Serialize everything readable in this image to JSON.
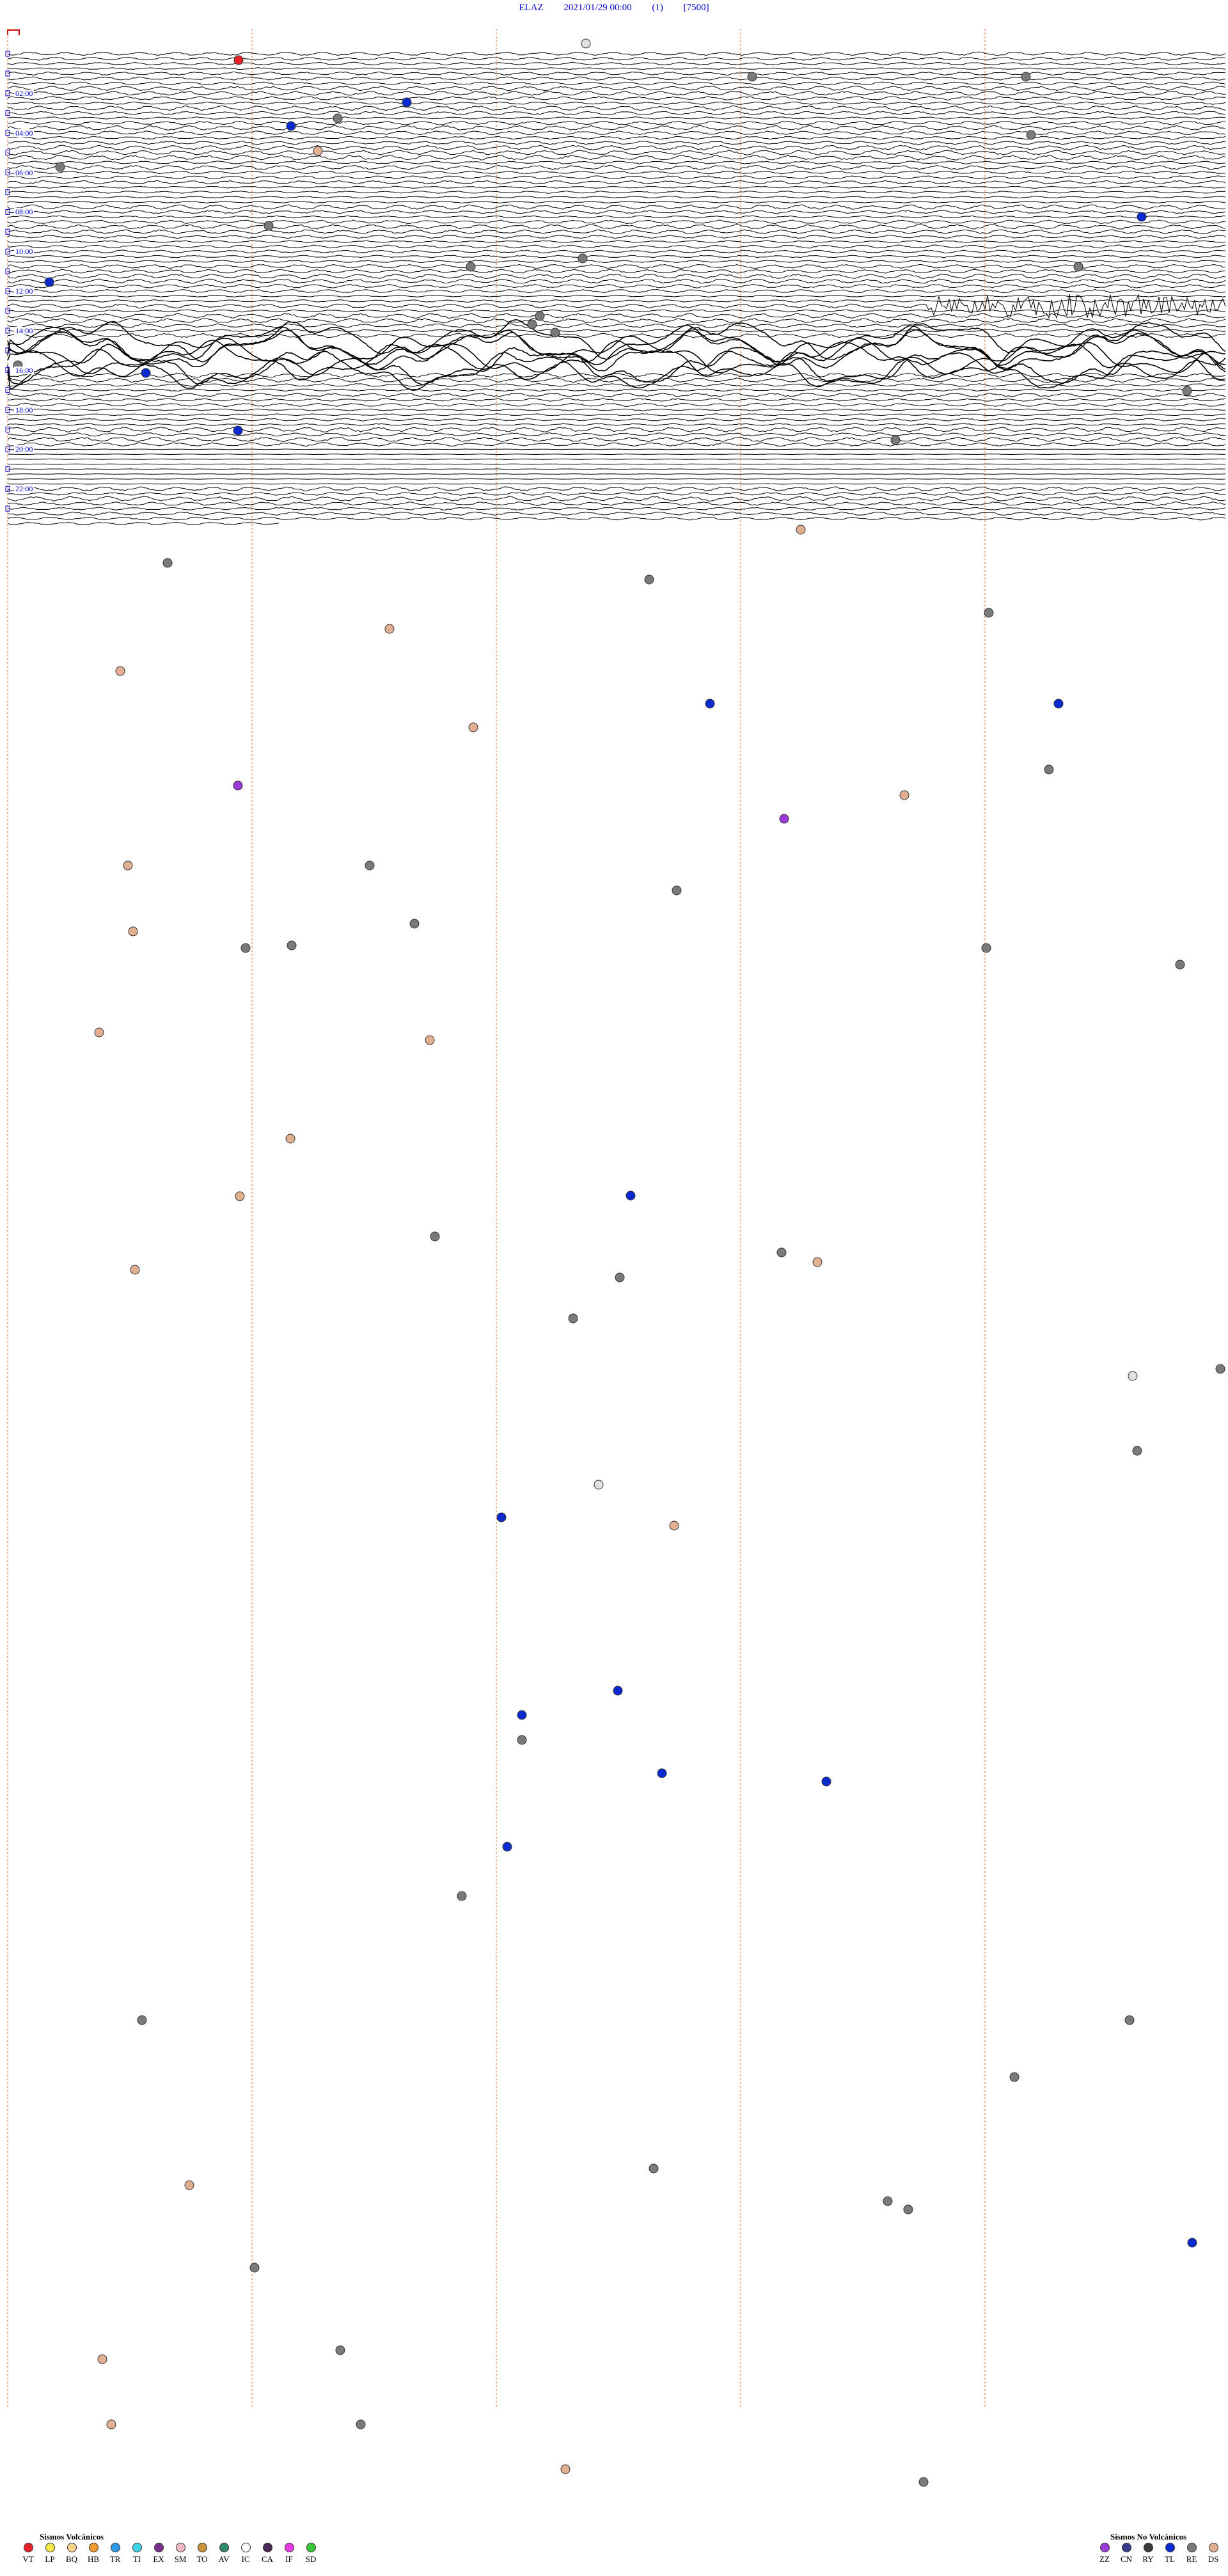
{
  "header": {
    "station": "ELAZ",
    "datetime": "2021/01/29 00:00",
    "channel": "(1)",
    "scale": "[7500]"
  },
  "chart_data": {
    "type": "line",
    "description_kind": "helicorder",
    "rows_per_hour": 4,
    "hours": 24,
    "hour_labels": [
      "02:00",
      "04:00",
      "06:00",
      "08:00",
      "10:00",
      "12:00",
      "14:00",
      "16:00",
      "18:00",
      "20:00",
      "22:00"
    ],
    "colors": {
      "trace": "#000000",
      "minute_grid": "#e07030",
      "hour_label": "#0000cc",
      "start_bracket": "#cc0000"
    }
  },
  "legend_volcanic": {
    "title": "Sismos Volcánicos",
    "items": [
      {
        "code": "VT",
        "color": "#e8202a"
      },
      {
        "code": "LP",
        "color": "#f6e84a"
      },
      {
        "code": "BQ",
        "color": "#f5d18a"
      },
      {
        "code": "HB",
        "color": "#f39a2f"
      },
      {
        "code": "TR",
        "color": "#2f9ae5"
      },
      {
        "code": "TI",
        "color": "#3fd5e8"
      },
      {
        "code": "EX",
        "color": "#7a2f8a"
      },
      {
        "code": "SM",
        "color": "#f3b8c8"
      },
      {
        "code": "TO",
        "color": "#c8913a"
      },
      {
        "code": "AV",
        "color": "#2e8a6a"
      },
      {
        "code": "IC",
        "color": "#ffffff"
      },
      {
        "code": "CA",
        "color": "#4a2a5a"
      },
      {
        "code": "IF",
        "color": "#e83ae0"
      },
      {
        "code": "SD",
        "color": "#3ac83a"
      }
    ]
  },
  "legend_nonvolcanic": {
    "title": "Sismos No Volcánicos",
    "items": [
      {
        "code": "ZZ",
        "color": "#9b3ad6"
      },
      {
        "code": "CN",
        "color": "#3a3a8a"
      },
      {
        "code": "RY",
        "color": "#3a3a3a"
      },
      {
        "code": "TL",
        "color": "#0a2ad0"
      },
      {
        "code": "RE",
        "color": "#7a7a7a"
      },
      {
        "code": "DS",
        "color": "#e0b090"
      }
    ]
  }
}
